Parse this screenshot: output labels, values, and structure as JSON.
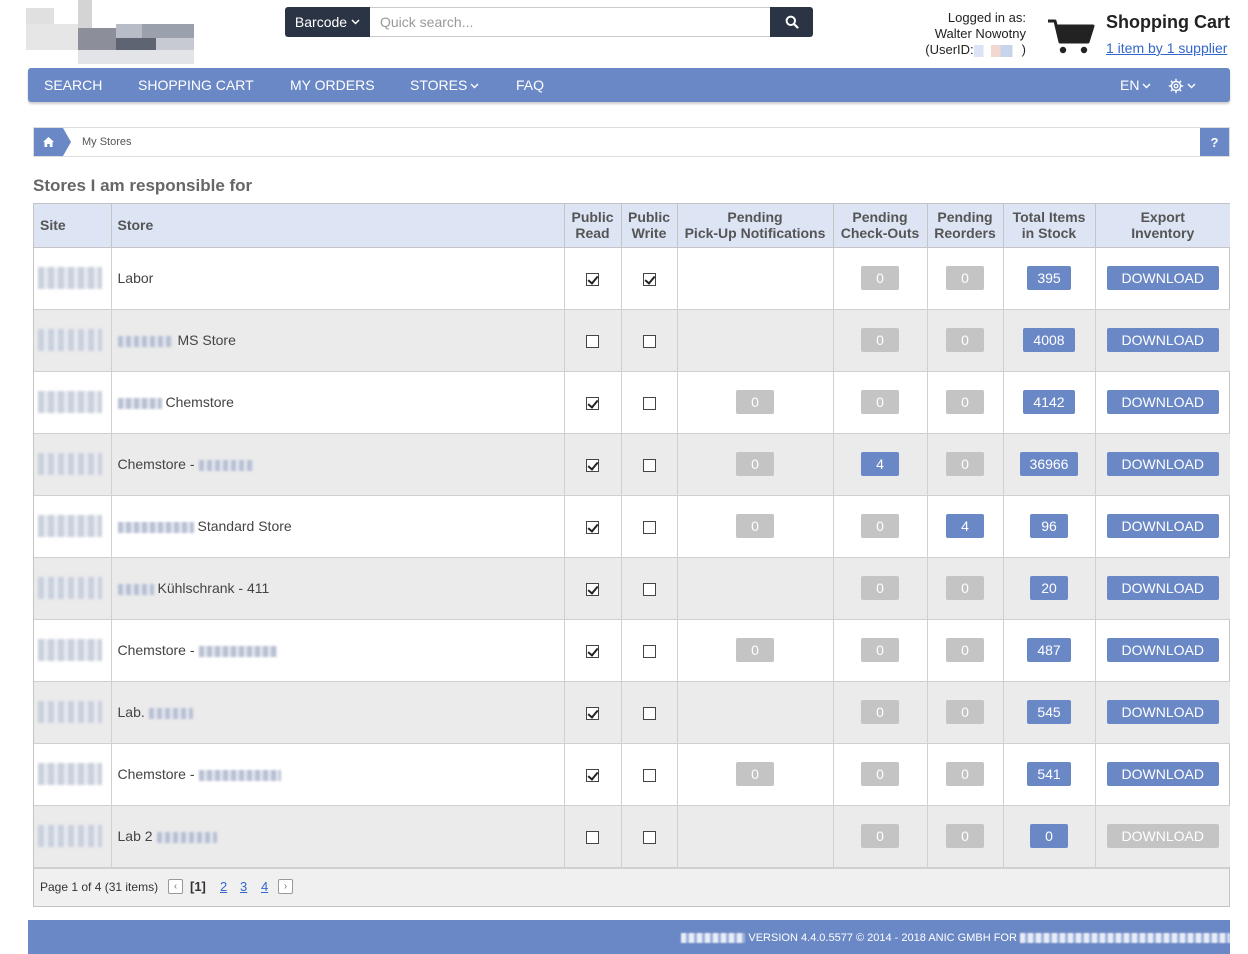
{
  "header": {
    "barcode_label": "Barcode",
    "search_placeholder": "Quick search...",
    "login_line1": "Logged in as:",
    "login_name": "Walter Nowotny",
    "login_userid_prefix": "(UserID:",
    "login_userid_suffix": ")",
    "cart_title": "Shopping Cart",
    "cart_link": "1 item by 1 supplier"
  },
  "nav": {
    "items": [
      "SEARCH",
      "SHOPPING CART",
      "MY ORDERS",
      "STORES",
      "FAQ"
    ],
    "language": "EN"
  },
  "breadcrumb": {
    "current": "My Stores",
    "help": "?"
  },
  "section_title": "Stores I am responsible for",
  "table": {
    "headers": {
      "site": "Site",
      "store": "Store",
      "public_read": [
        "Public",
        "Read"
      ],
      "public_write": [
        "Public",
        "Write"
      ],
      "pickup": [
        "Pending",
        "Pick-Up Notifications"
      ],
      "checkouts": [
        "Pending",
        "Check-Outs"
      ],
      "reorders": [
        "Pending",
        "Reorders"
      ],
      "total": [
        "Total Items",
        "in Stock"
      ],
      "export": [
        "Export",
        "Inventory"
      ]
    },
    "download_label": "DOWNLOAD",
    "rows": [
      {
        "store": "Labor",
        "read": true,
        "write": true,
        "pickup": null,
        "checkouts": "0",
        "reorders": "0",
        "total": "395",
        "download_enabled": true
      },
      {
        "store": "MS Store",
        "read": false,
        "write": false,
        "pickup": null,
        "checkouts": "0",
        "reorders": "0",
        "total": "4008",
        "download_enabled": true
      },
      {
        "store": "Chemstore",
        "read": true,
        "write": false,
        "pickup": "0",
        "checkouts": "0",
        "reorders": "0",
        "total": "4142",
        "download_enabled": true
      },
      {
        "store": "Chemstore -",
        "read": true,
        "write": false,
        "pickup": "0",
        "checkouts": "4",
        "reorders": "0",
        "total": "36966",
        "download_enabled": true
      },
      {
        "store": "Standard Store",
        "read": true,
        "write": false,
        "pickup": "0",
        "checkouts": "0",
        "reorders": "4",
        "total": "96",
        "download_enabled": true
      },
      {
        "store": "Kühlschrank - 411",
        "read": true,
        "write": false,
        "pickup": null,
        "checkouts": "0",
        "reorders": "0",
        "total": "20",
        "download_enabled": true
      },
      {
        "store": "Chemstore -",
        "read": true,
        "write": false,
        "pickup": "0",
        "checkouts": "0",
        "reorders": "0",
        "total": "487",
        "download_enabled": true
      },
      {
        "store": "Lab.",
        "read": true,
        "write": false,
        "pickup": null,
        "checkouts": "0",
        "reorders": "0",
        "total": "545",
        "download_enabled": true
      },
      {
        "store": "Chemstore -",
        "read": true,
        "write": false,
        "pickup": "0",
        "checkouts": "0",
        "reorders": "0",
        "total": "541",
        "download_enabled": true
      },
      {
        "store": "Lab 2",
        "read": false,
        "write": false,
        "pickup": null,
        "checkouts": "0",
        "reorders": "0",
        "total": "0",
        "download_enabled": false
      }
    ]
  },
  "pager": {
    "summary": "Page 1 of 4 (31 items)",
    "current": "[1]",
    "pages": [
      "2",
      "3",
      "4"
    ]
  },
  "footer": {
    "text": "VERSION 4.4.0.5577 © 2014 - 2018 ANIC GMBH FOR"
  }
}
